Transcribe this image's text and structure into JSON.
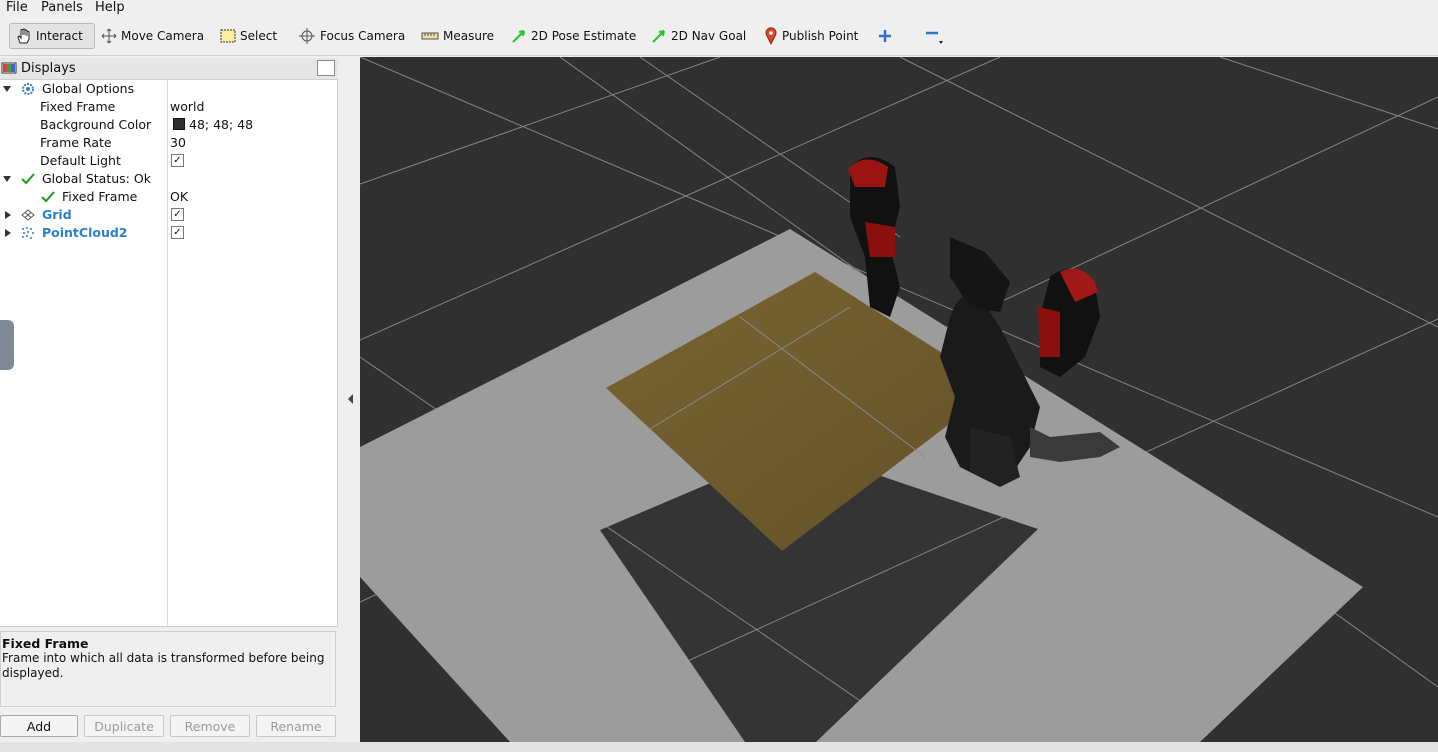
{
  "menu": {
    "file": "File",
    "panels": "Panels",
    "help": "Help"
  },
  "toolbar": {
    "interact": "Interact",
    "move_camera": "Move Camera",
    "select": "Select",
    "focus_camera": "Focus Camera",
    "measure": "Measure",
    "pose_estimate": "2D Pose Estimate",
    "nav_goal": "2D Nav Goal",
    "publish_point": "Publish Point"
  },
  "displays": {
    "title": "Displays",
    "global_options": {
      "label": "Global Options",
      "fixed_frame_label": "Fixed Frame",
      "fixed_frame_value": "world",
      "background_color_label": "Background Color",
      "background_color_value": "48; 48; 48",
      "frame_rate_label": "Frame Rate",
      "frame_rate_value": "30",
      "default_light_label": "Default Light",
      "default_light_checked": true
    },
    "global_status": {
      "label": "Global Status: Ok",
      "fixed_frame_label": "Fixed Frame",
      "fixed_frame_value": "OK"
    },
    "grid": {
      "label": "Grid",
      "checked": true
    },
    "pointcloud": {
      "label": "PointCloud2",
      "checked": true
    }
  },
  "description": {
    "title": "Fixed Frame",
    "text": "Frame into which all data is transformed before being displayed."
  },
  "buttons": {
    "add": "Add",
    "duplicate": "Duplicate",
    "remove": "Remove",
    "rename": "Rename"
  },
  "colors": {
    "background": "#303030",
    "accent": "#2a7fd0",
    "status_ok": "#1a9a1a"
  }
}
